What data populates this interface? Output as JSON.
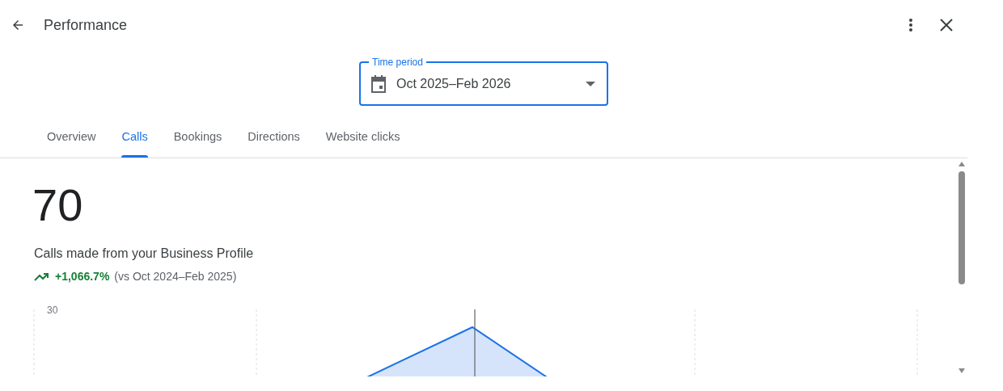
{
  "header": {
    "title": "Performance"
  },
  "time_period": {
    "label": "Time period",
    "value": "Oct 2025–Feb 2026"
  },
  "tabs": [
    {
      "label": "Overview",
      "selected": false
    },
    {
      "label": "Calls",
      "selected": true
    },
    {
      "label": "Bookings",
      "selected": false
    },
    {
      "label": "Directions",
      "selected": false
    },
    {
      "label": "Website clicks",
      "selected": false
    }
  ],
  "metric": {
    "value": "70",
    "description": "Calls made from your Business Profile",
    "change": "+1,066.7%",
    "comparison": "(vs Oct 2024–Feb 2025)"
  },
  "chart": {
    "y_tick_label": "30"
  }
}
